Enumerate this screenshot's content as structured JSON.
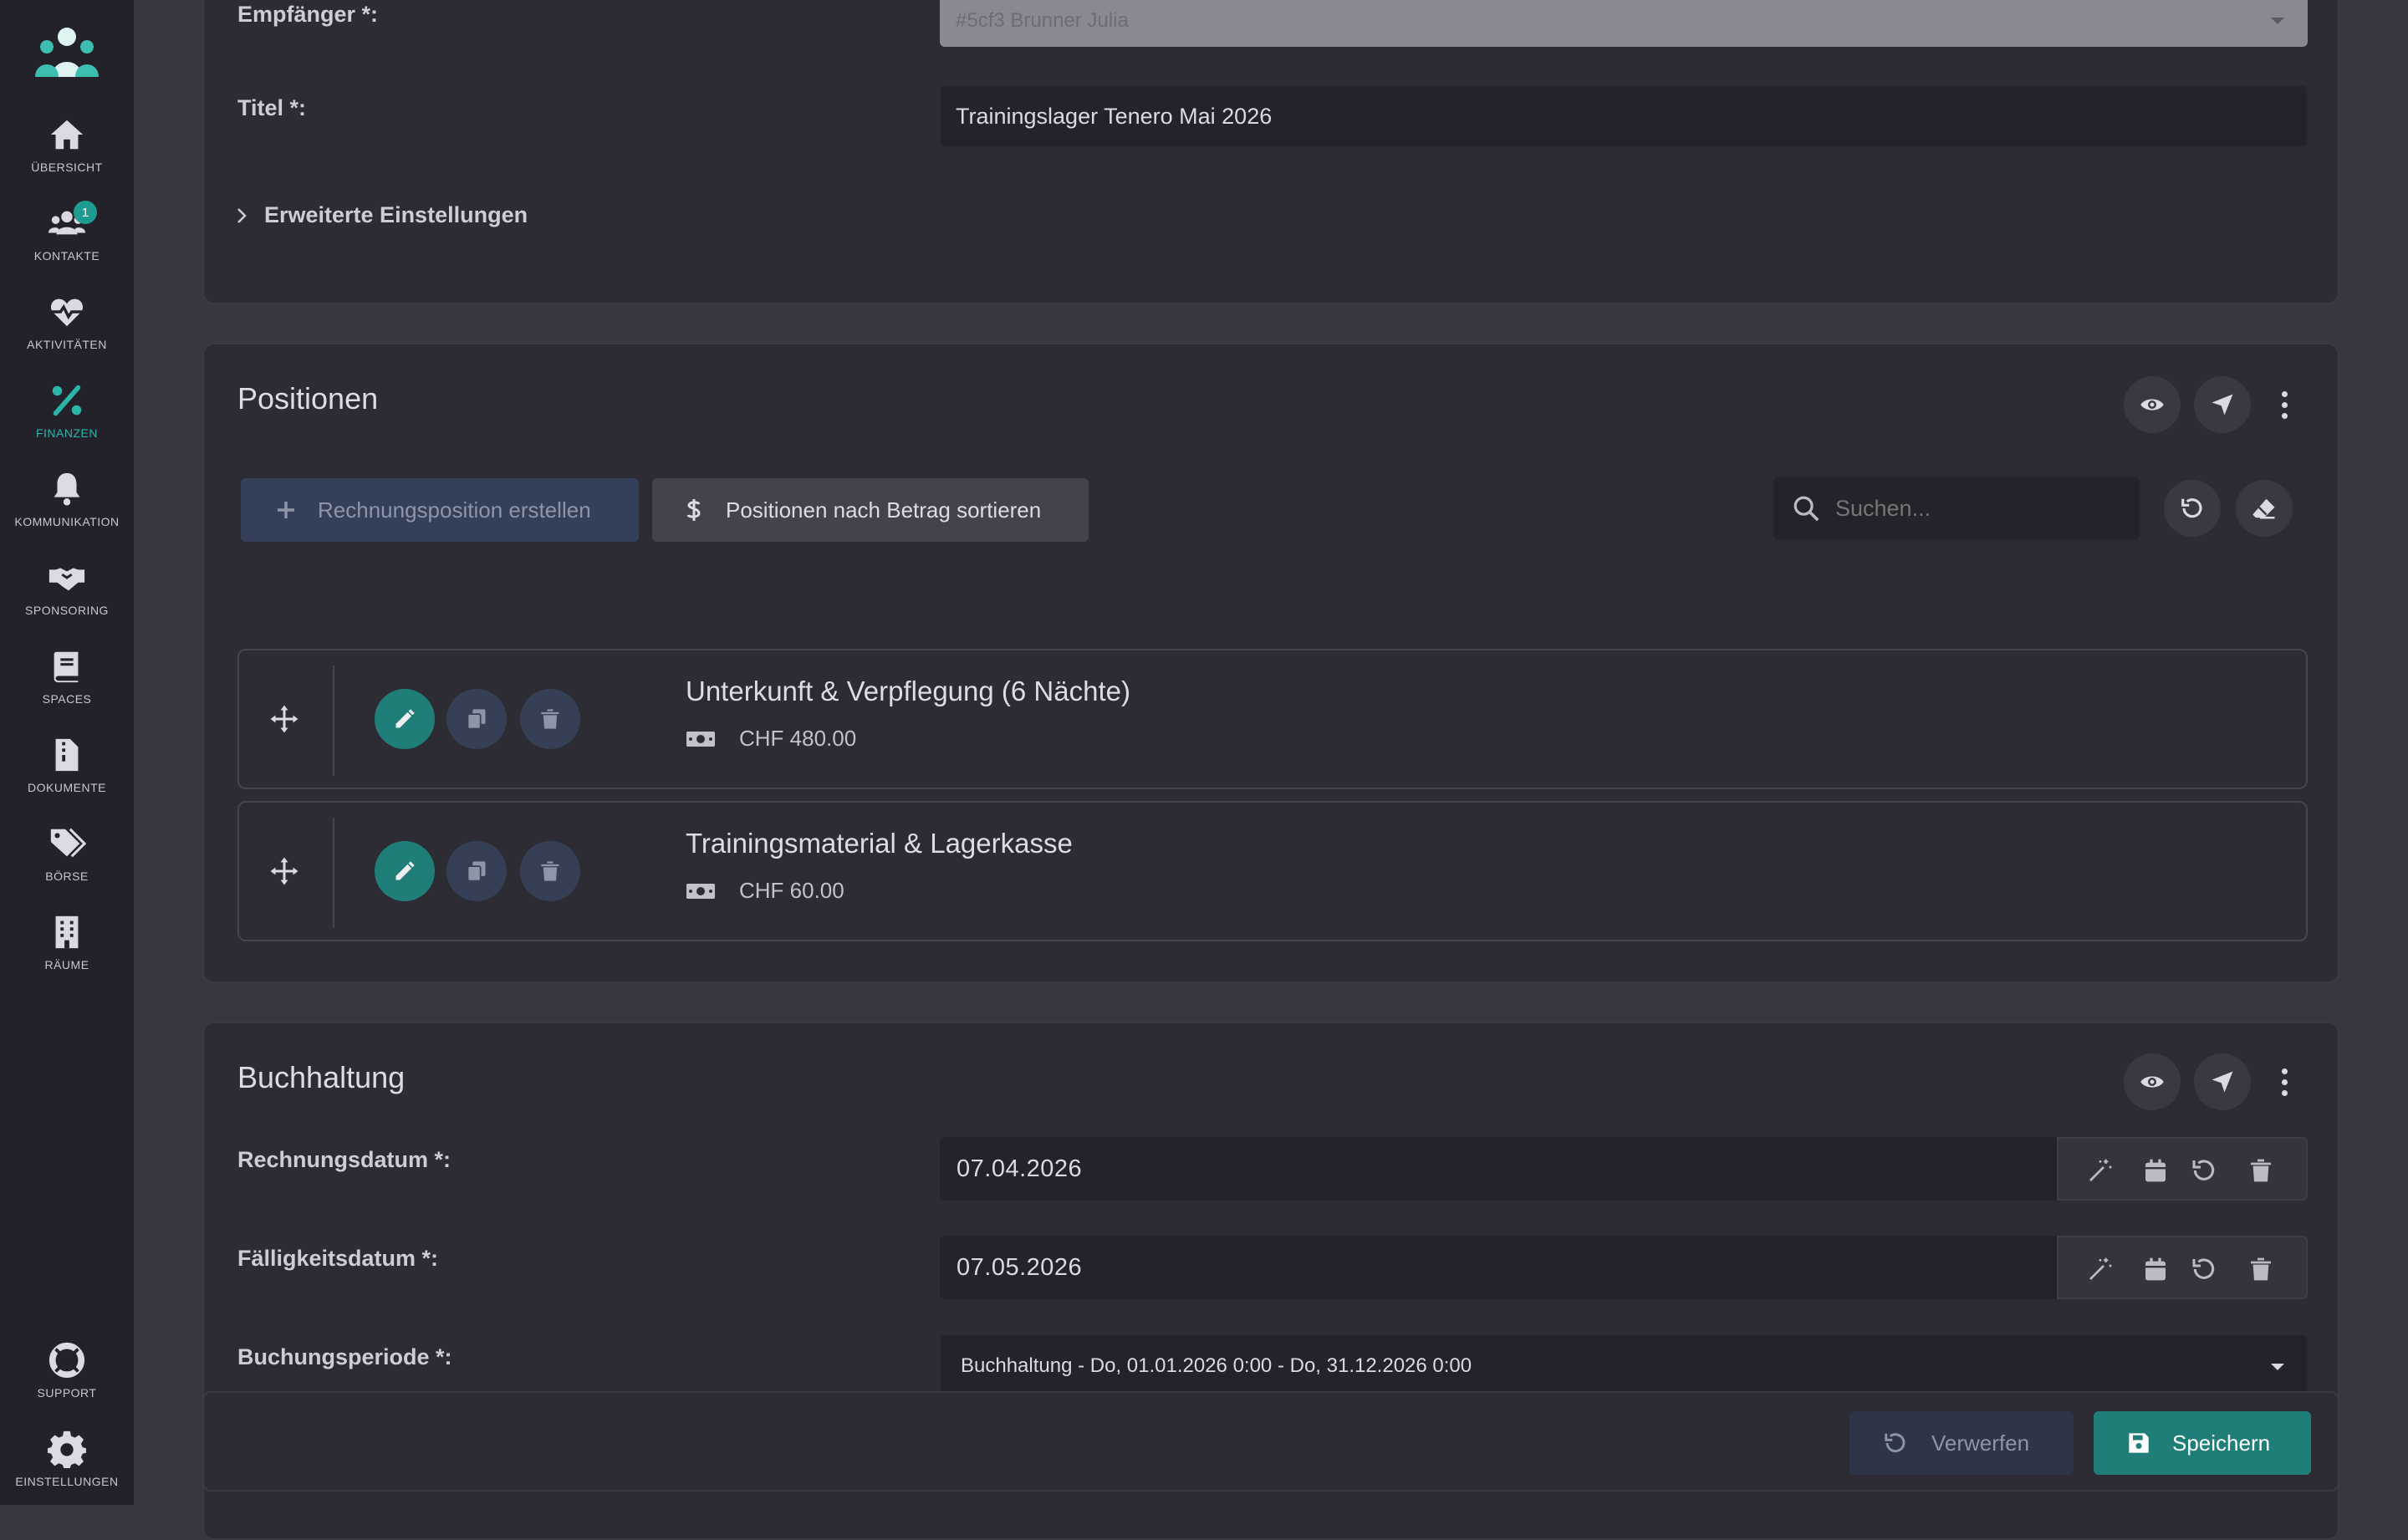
{
  "sidebar": {
    "items": [
      {
        "label": "ÜBERSICHT",
        "icon": "home-icon"
      },
      {
        "label": "KONTAKTE",
        "icon": "users-icon",
        "badge": "1"
      },
      {
        "label": "AKTIVITÄTEN",
        "icon": "heart-pulse-icon"
      },
      {
        "label": "FINANZEN",
        "icon": "percent-icon",
        "active": true
      },
      {
        "label": "KOMMUNIKATION",
        "icon": "bell-icon"
      },
      {
        "label": "SPONSORING",
        "icon": "handshake-icon"
      },
      {
        "label": "SPACES",
        "icon": "book-icon"
      },
      {
        "label": "DOKUMENTE",
        "icon": "file-zipper-icon"
      },
      {
        "label": "BÖRSE",
        "icon": "tags-icon"
      },
      {
        "label": "RÄUME",
        "icon": "building-icon"
      }
    ],
    "bottom": [
      {
        "label": "SUPPORT",
        "icon": "life-ring-icon"
      },
      {
        "label": "EINSTELLUNGEN",
        "icon": "gear-icon"
      }
    ]
  },
  "general": {
    "recipient_label": "Empfänger *:",
    "recipient_value": "#5cf3 Brunner Julia",
    "title_label": "Titel *:",
    "title_value": "Trainingslager Tenero Mai 2026",
    "advanced_label": "Erweiterte Einstellungen"
  },
  "positions": {
    "title": "Positionen",
    "create_button": "Rechnungsposition erstellen",
    "sort_button": "Positionen nach Betrag sortieren",
    "search_placeholder": "Suchen...",
    "items": [
      {
        "title": "Unterkunft & Verpflegung (6 Nächte)",
        "amount": "CHF 480.00"
      },
      {
        "title": "Trainingsmaterial & Lagerkasse",
        "amount": "CHF 60.00"
      }
    ]
  },
  "accounting": {
    "title": "Buchhaltung",
    "invoice_date_label": "Rechnungsdatum *:",
    "invoice_date_value": "07.04.2026",
    "due_date_label": "Fälligkeitsdatum *:",
    "due_date_value": "07.05.2026",
    "period_label": "Buchungsperiode *:",
    "period_value": "Buchhaltung - Do, 01.01.2026 0:00 - Do, 31.12.2026 0:00"
  },
  "footer": {
    "discard_button": "Verwerfen",
    "save_button": "Speichern"
  },
  "colors": {
    "accent": "#1f7f78",
    "accent_light": "#2bb5a8",
    "sidebar_bg": "#23222a",
    "card_bg": "#2d2b33"
  }
}
